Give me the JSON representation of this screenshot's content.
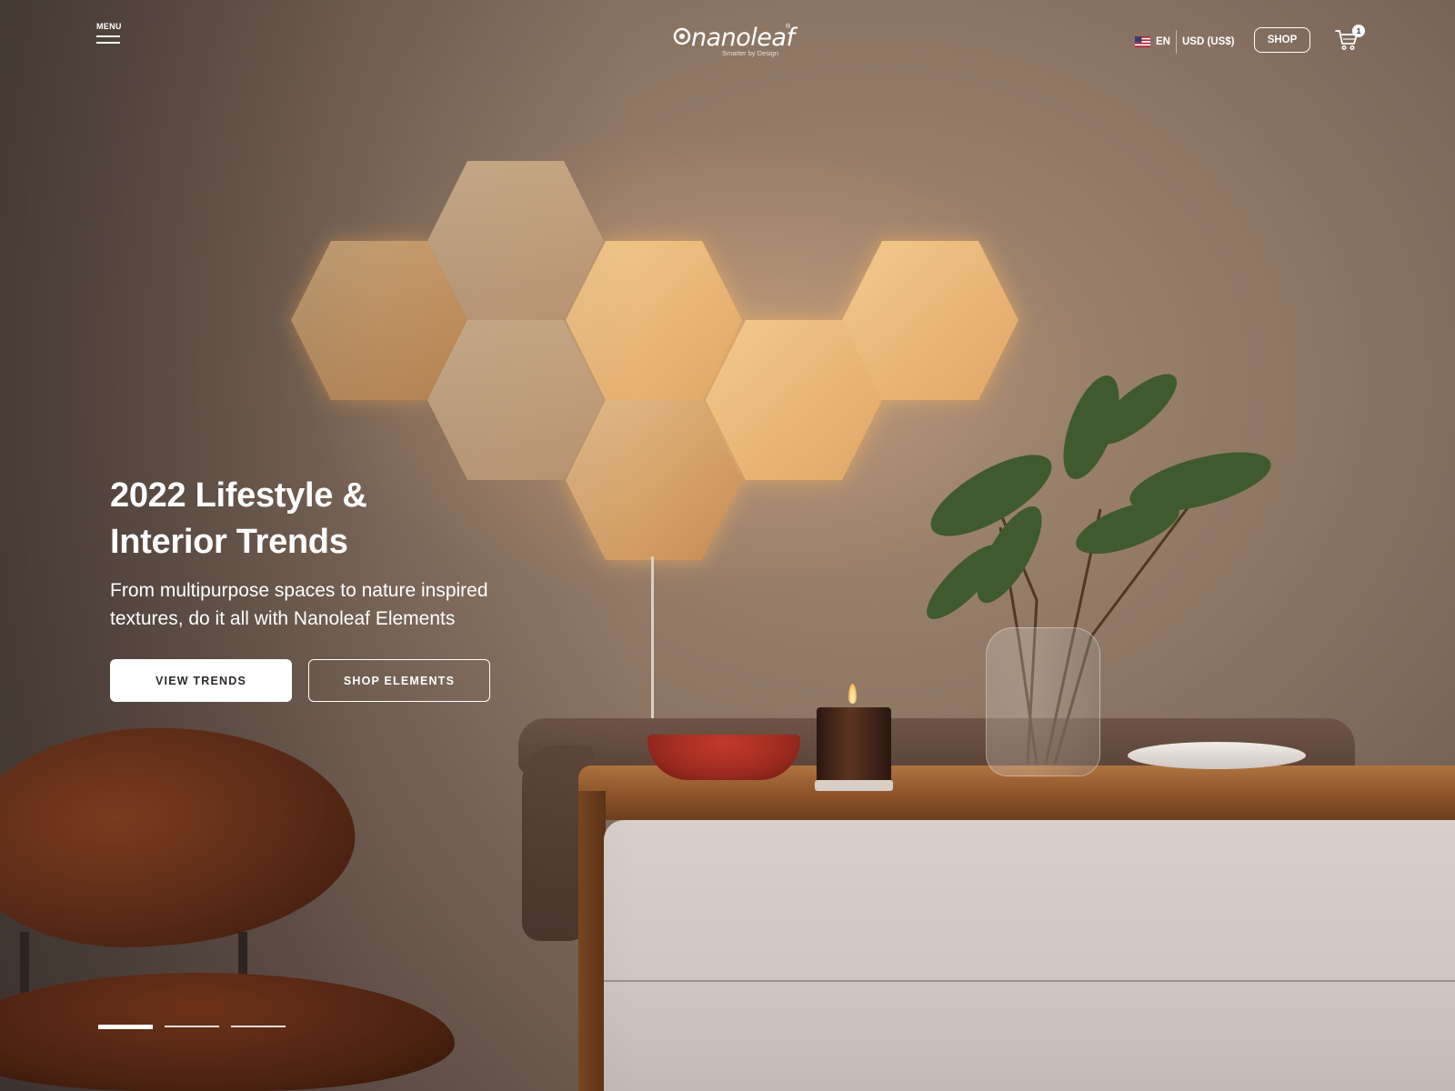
{
  "header": {
    "menu_label": "MENU",
    "logo_text": "nanoleaf",
    "logo_reg": "®",
    "logo_tagline": "Smarter by Design",
    "language": "EN",
    "currency": "USD (US$)",
    "shop_label": "SHOP",
    "cart_count": "1"
  },
  "icons": {
    "menu": "hamburger-icon",
    "flag": "us-flag-icon",
    "cart": "cart-icon",
    "logo": "nanoleaf-logo-icon"
  },
  "hero": {
    "title_line1": "2022 Lifestyle &",
    "title_line2": "Interior Trends",
    "subtitle_line1": "From multipurpose spaces to nature inspired",
    "subtitle_line2": "textures, do it all with Nanoleaf Elements",
    "primary_cta": "VIEW TRENDS",
    "secondary_cta": "SHOP ELEMENTS"
  },
  "carousel": {
    "slide_count": 3,
    "active_index": 0
  },
  "colors": {
    "text": "#ffffff",
    "primary_button_bg": "#ffffff",
    "primary_button_text": "#2a2a2a"
  }
}
